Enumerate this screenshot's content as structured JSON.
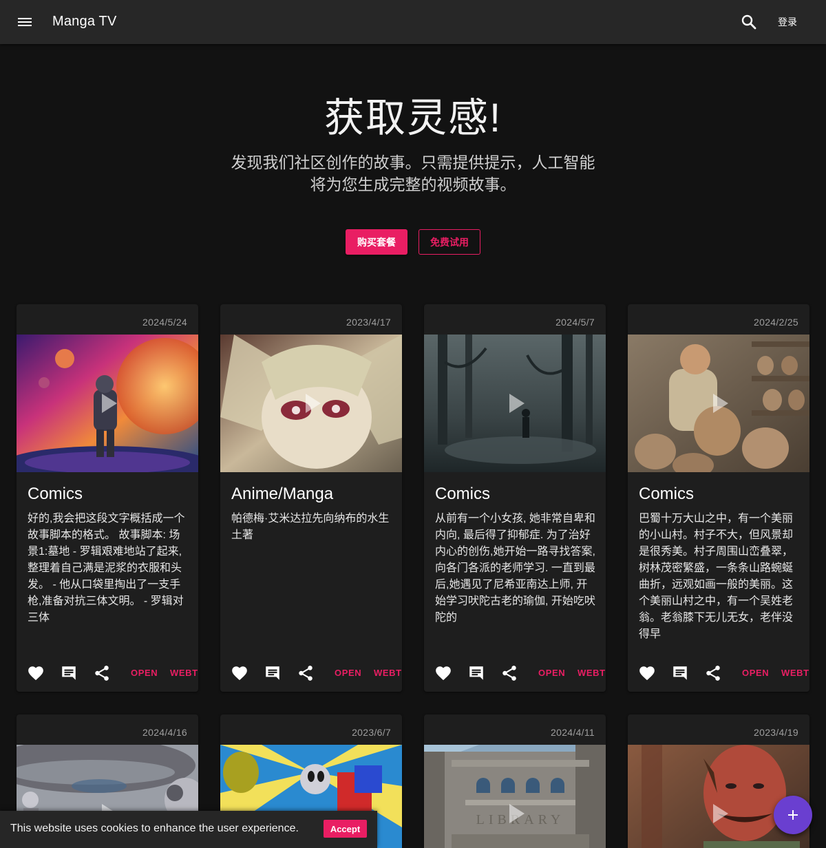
{
  "header": {
    "app_title": "Manga TV",
    "menu_icon": "menu-icon",
    "search_icon": "search-icon",
    "login_label": "登录"
  },
  "hero": {
    "title": "获取灵感!",
    "subtitle_line1": "发现我们社区创作的故事。只需提供提示，人工智能",
    "subtitle_line2": "将为您生成完整的视频故事。",
    "buy_label": "购买套餐",
    "trial_label": "免费试用"
  },
  "colors": {
    "accent": "#e91e63",
    "fab": "#6a3fd0",
    "appbar": "#272727",
    "background": "#121212",
    "card": "#1e1e1e"
  },
  "card_actions": {
    "open_label": "OPEN",
    "webtoon_label": "WEBTO",
    "icons": [
      "heart-icon",
      "comment-icon",
      "share-icon"
    ]
  },
  "cards_row1": [
    {
      "date": "2024/5/24",
      "category": "Comics",
      "description": "好的,我会把这段文字概括成一个故事脚本的格式。 故事脚本: 场景1:墓地 - 罗辑艰难地站了起来,整理着自己满是泥浆的衣服和头发。 - 他从口袋里掏出了一支手枪,准备对抗三体文明。 - 罗辑对三体"
    },
    {
      "date": "2023/4/17",
      "category": "Anime/Manga",
      "description": "帕德梅·艾米达拉先向纳布的水生土著"
    },
    {
      "date": "2024/5/7",
      "category": "Comics",
      "description": "从前有一个小女孩, 她非常自卑和内向, 最后得了抑郁症. 为了治好内心的创伤,她开始一路寻找答案, 向各门各派的老师学习. 一直到最后,她遇见了尼希亚南达上师, 开始学习吠陀古老的瑜伽, 开始吃吠陀的"
    },
    {
      "date": "2024/2/25",
      "category": "Comics",
      "description": "巴蜀十万大山之中，有一个美丽的小山村。村子不大，但风景却是很秀美。村子周围山峦叠翠，树林茂密繁盛，一条条山路蜿蜒曲折，远观如画一般的美丽。这个美丽山村之中，有一个吴姓老翁。老翁膝下无儿无女，老伴没得早"
    }
  ],
  "cards_row2": [
    {
      "date": "2024/4/16"
    },
    {
      "date": "2023/6/7"
    },
    {
      "date": "2024/4/11"
    },
    {
      "date": "2023/4/19"
    }
  ],
  "cookie": {
    "text": "This website uses cookies to enhance the user experience.",
    "accept_label": "Accept"
  },
  "fab_icon": "plus-icon"
}
